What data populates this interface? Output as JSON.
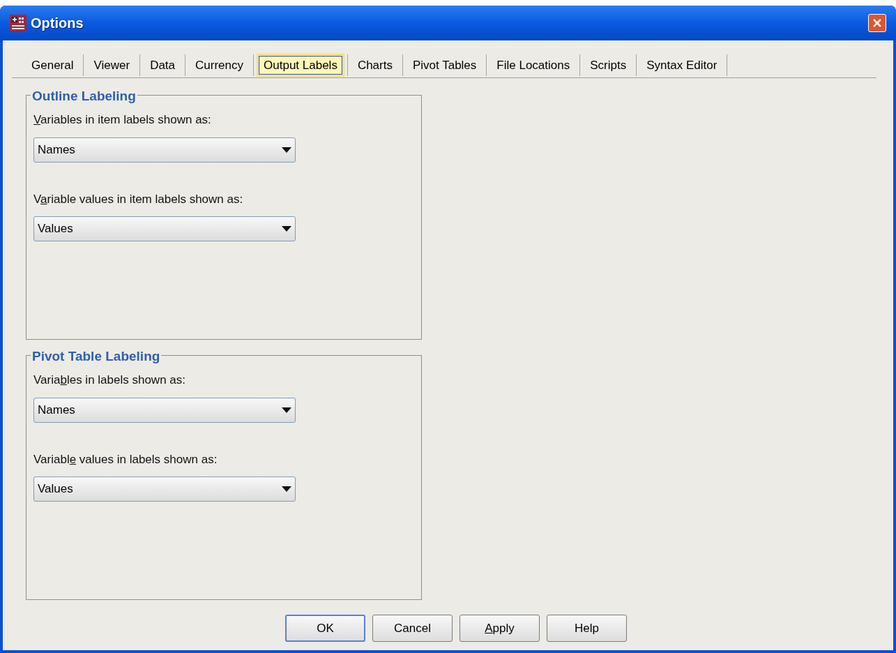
{
  "window": {
    "title": "Options"
  },
  "tabs": [
    {
      "label": "General",
      "selected": false
    },
    {
      "label": "Viewer",
      "selected": false
    },
    {
      "label": "Data",
      "selected": false
    },
    {
      "label": "Currency",
      "selected": false
    },
    {
      "label": "Output Labels",
      "selected": true
    },
    {
      "label": "Charts",
      "selected": false
    },
    {
      "label": "Pivot Tables",
      "selected": false
    },
    {
      "label": "File Locations",
      "selected": false
    },
    {
      "label": "Scripts",
      "selected": false
    },
    {
      "label": "Syntax Editor",
      "selected": false
    }
  ],
  "groups": [
    {
      "title": "Outline Labeling",
      "fields": [
        {
          "label": {
            "key": "V",
            "after": "ariables in item labels shown as:"
          },
          "value": "Names"
        },
        {
          "label": {
            "before": "V",
            "key": "a",
            "after": "riable values in item labels shown as:"
          },
          "value": "Values"
        }
      ]
    },
    {
      "title": "Pivot Table Labeling",
      "fields": [
        {
          "label": {
            "before": "Varia",
            "key": "b",
            "after": "les in labels shown as:"
          },
          "value": "Names"
        },
        {
          "label": {
            "before": "Variabl",
            "key": "e",
            "after": " values in labels shown as:"
          },
          "value": "Values"
        }
      ]
    }
  ],
  "buttons": [
    {
      "label": {
        "before": "OK"
      },
      "default": true
    },
    {
      "label": {
        "before": "Cancel"
      },
      "default": false
    },
    {
      "label": {
        "key": "A",
        "after": "pply"
      },
      "default": false
    },
    {
      "label": {
        "before": "Help"
      },
      "default": false
    }
  ]
}
